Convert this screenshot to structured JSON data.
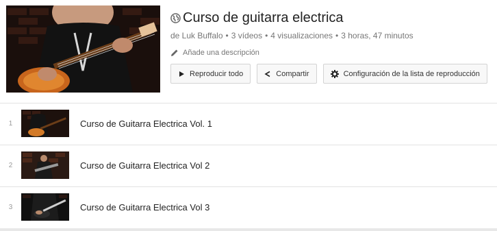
{
  "playlist": {
    "title": "Curso de guitarra electrica",
    "author": "de Luk Buffalo",
    "video_count": "3 vídeos",
    "views": "4 visualizaciones",
    "duration": "3 horas, 47 minutos",
    "separator": "•",
    "add_description": "Añade una descripción"
  },
  "actions": {
    "play_all": "Reproducir todo",
    "share": "Compartir",
    "settings": "Configuración de la lista de reproducción"
  },
  "videos": [
    {
      "index": "1",
      "title": "Curso de Guitarra Electrica Vol. 1"
    },
    {
      "index": "2",
      "title": "Curso de Guitarra Electrica Vol 2"
    },
    {
      "index": "3",
      "title": "Curso de Guitarra Electrica Vol 3"
    }
  ],
  "colors": {
    "text_primary": "#222222",
    "text_secondary": "#767676",
    "button_bg": "#f8f8f8",
    "border": "#d3d3d3"
  },
  "icons": [
    "globe-icon",
    "pencil-icon",
    "play-icon",
    "share-icon",
    "gear-icon"
  ]
}
